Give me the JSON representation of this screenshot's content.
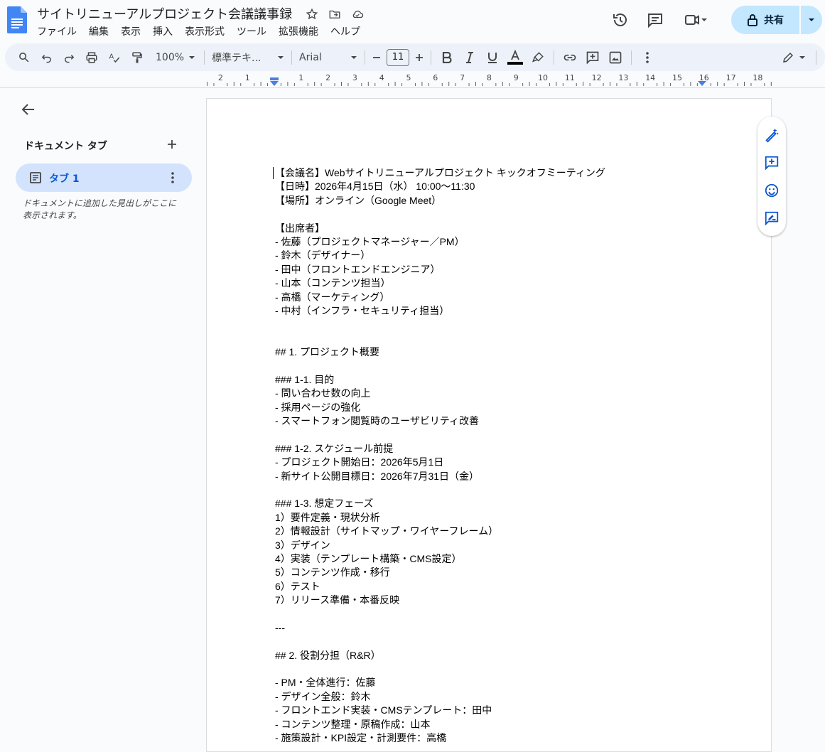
{
  "app": {
    "title": "サイトリニューアルプロジェクト会議議事録",
    "menu": [
      "ファイル",
      "編集",
      "表示",
      "挿入",
      "表示形式",
      "ツール",
      "拡張機能",
      "ヘルプ"
    ],
    "share_label": "共有"
  },
  "toolbar": {
    "zoom": "100%",
    "style": "標準テキ...",
    "font": "Arial",
    "font_size": "11",
    "text_color_underline": "#000000"
  },
  "ruler": {
    "ticks": [
      "2",
      "1",
      "1",
      "2",
      "3",
      "4",
      "5",
      "6",
      "7",
      "8",
      "9",
      "10",
      "11",
      "12",
      "13",
      "14",
      "15",
      "16",
      "17",
      "18"
    ]
  },
  "sidebar": {
    "title": "ドキュメント タブ",
    "tab_label": "タブ 1",
    "hint": "ドキュメントに追加した見出しがここに表示されます。"
  },
  "document": {
    "lines": [
      "【会議名】Webサイトリニューアルプロジェクト キックオフミーティング",
      "【日時】2026年4月15日（水） 10:00〜11:30",
      "【場所】オンライン（Google Meet）",
      "",
      "【出席者】",
      "- 佐藤（プロジェクトマネージャー／PM）",
      "- 鈴木（デザイナー）",
      "- 田中（フロントエンドエンジニア）",
      "- 山本（コンテンツ担当）",
      "- 高橋（マーケティング）",
      "- 中村（インフラ・セキュリティ担当）",
      "",
      "",
      "## 1. プロジェクト概要",
      "",
      "### 1-1. 目的",
      "- 問い合わせ数の向上",
      "- 採用ページの強化",
      "- スマートフォン閲覧時のユーザビリティ改善",
      "",
      "### 1-2. スケジュール前提",
      "- プロジェクト開始日：2026年5月1日",
      "- 新サイト公開目標日：2026年7月31日（金）",
      "",
      "### 1-3. 想定フェーズ",
      "1）要件定義・現状分析",
      "2）情報設計（サイトマップ・ワイヤーフレーム）",
      "3）デザイン",
      "4）実装（テンプレート構築・CMS設定）",
      "5）コンテンツ作成・移行",
      "6）テスト",
      "7）リリース準備・本番反映",
      "",
      "---",
      "",
      "## 2. 役割分担（R&R）",
      "",
      "- PM・全体進行：佐藤",
      "- デザイン全般：鈴木",
      "- フロントエンド実装・CMSテンプレート：田中",
      "- コンテンツ整理・原稿作成：山本",
      "- 施策設計・KPI設定・計測要件：高橋"
    ]
  },
  "colors": {
    "accent": "#0b57d0",
    "share_bg": "#c2e7ff",
    "tab_bg": "#d3e3fd",
    "toolbar_bg": "#edf2fa"
  }
}
